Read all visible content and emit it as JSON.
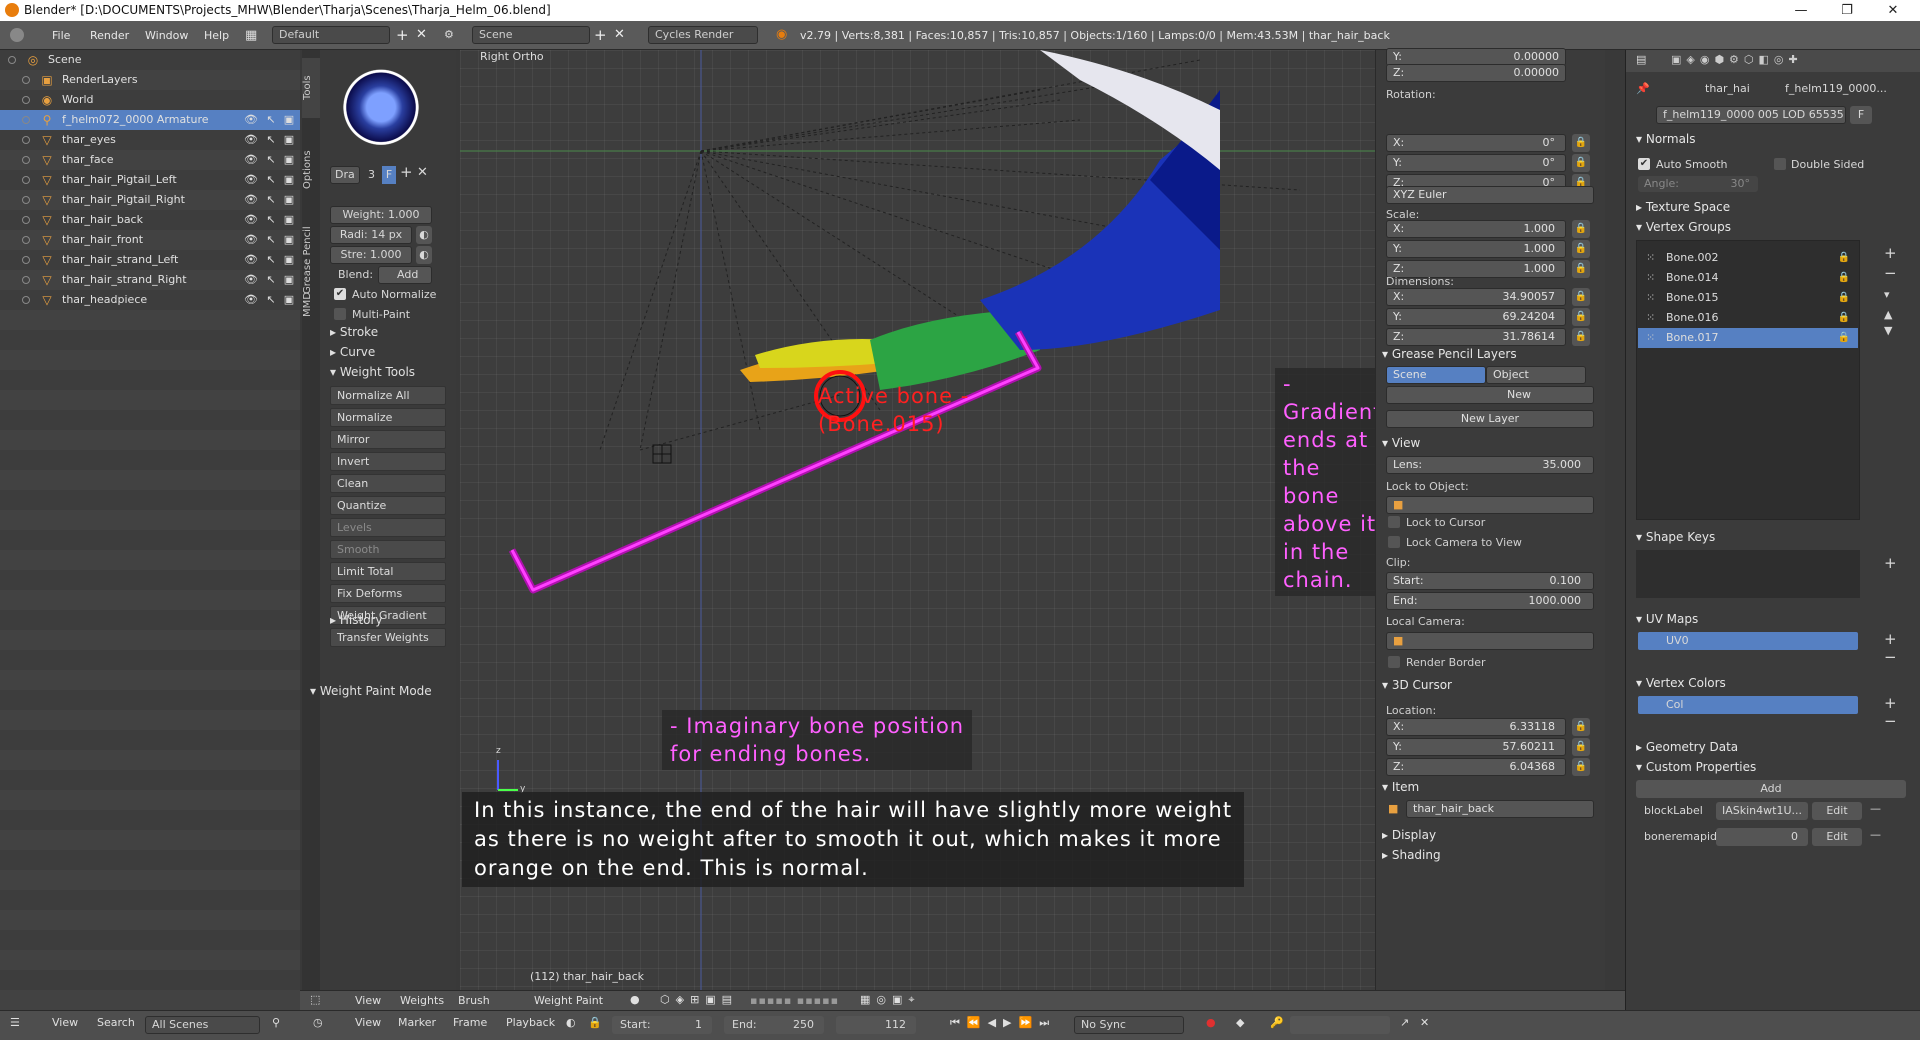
{
  "window": {
    "title": "Blender* [D:\\DOCUMENTS\\Projects_MHW\\Blender\\Tharja\\Scenes\\Tharja_Helm_06.blend]"
  },
  "infobar": {
    "menus": [
      "File",
      "Render",
      "Window",
      "Help"
    ],
    "layout": "Default",
    "scene": "Scene",
    "engine": "Cycles Render",
    "stats": "v2.79 | Verts:8,381 | Faces:10,857 | Tris:10,857 | Objects:1/160 | Lamps:0/0 | Mem:43.53M | thar_hair_back"
  },
  "outliner": {
    "items": [
      {
        "label": "Scene",
        "icon": "scene-icon"
      },
      {
        "label": "RenderLayers",
        "icon": "renderlayers-icon"
      },
      {
        "label": "World",
        "icon": "world-icon"
      },
      {
        "label": "f_helm072_0000 Armature",
        "icon": "armature-icon"
      },
      {
        "label": "thar_eyes",
        "icon": "mesh-icon"
      },
      {
        "label": "thar_face",
        "icon": "mesh-icon"
      },
      {
        "label": "thar_hair_Pigtail_Left",
        "icon": "mesh-icon"
      },
      {
        "label": "thar_hair_Pigtail_Right",
        "icon": "mesh-icon"
      },
      {
        "label": "thar_hair_back",
        "icon": "mesh-icon"
      },
      {
        "label": "thar_hair_front",
        "icon": "mesh-icon"
      },
      {
        "label": "thar_hair_strand_Left",
        "icon": "mesh-icon"
      },
      {
        "label": "thar_hair_strand_Right",
        "icon": "mesh-icon"
      },
      {
        "label": "thar_headpiece",
        "icon": "mesh-icon"
      }
    ]
  },
  "tabs": [
    "Tools",
    "Options",
    "Grease Pencil",
    "MMD"
  ],
  "toolshelf": {
    "brush_name": "Dra",
    "brush_users": "3",
    "brush_fake": "F",
    "weight": "Weight: 1.000",
    "radius": "Radi: 14 px",
    "strength": "Stre: 1.000",
    "blend_label": "Blend:",
    "blend_value": "Add",
    "auto_normalize": "Auto Normalize",
    "multi_paint": "Multi-Paint",
    "stroke": "Stroke",
    "curve": "Curve",
    "weight_tools": "Weight Tools",
    "tools": [
      "Normalize All",
      "Normalize",
      "Mirror",
      "Invert",
      "Clean",
      "Quantize",
      "Levels",
      "Smooth",
      "Limit Total",
      "Fix Deforms",
      "Weight Gradient",
      "Transfer Weights"
    ],
    "history": "History",
    "mode_panel": "Weight Paint Mode"
  },
  "viewport": {
    "view_name": "Right Ortho",
    "object_label": "(112) thar_hair_back",
    "axis_z": "z",
    "axis_y": "y"
  },
  "annotations": {
    "active_bone": [
      "Active bone -",
      "(Bone.015)"
    ],
    "gradient": [
      "- Gradient ends at the bone",
      "above it in the chain."
    ],
    "imaginary": [
      "- Imaginary bone position",
      "for ending bones."
    ],
    "note": [
      "In this instance, the end of the hair will have slightly more weight",
      "as there is no weight after to smooth it out, which makes it more",
      "orange on the end. This is normal."
    ]
  },
  "npanel": {
    "loc_y": "0.00000",
    "loc_z": "0.00000",
    "rotation_label": "Rotation:",
    "rot": [
      "0°",
      "0°",
      "0°"
    ],
    "rot_mode": "XYZ Euler",
    "scale_label": "Scale:",
    "scale": [
      "1.000",
      "1.000",
      "1.000"
    ],
    "dimensions_label": "Dimensions:",
    "dims": [
      "34.90057",
      "69.24204",
      "31.78614"
    ],
    "axes": [
      "X:",
      "Y:",
      "Z:"
    ],
    "gp_layers": "Grease Pencil Layers",
    "gp_scene": "Scene",
    "gp_object": "Object",
    "gp_new": "New",
    "new_layer": "New Layer",
    "view": "View",
    "lens_label": "Lens:",
    "lens": "35.000",
    "lock_to_object": "Lock to Object:",
    "lock_to_cursor": "Lock to Cursor",
    "lock_camera": "Lock Camera to View",
    "clip": "Clip:",
    "start_label": "Start:",
    "start": "0.100",
    "end_label": "End:",
    "end": "1000.000",
    "local_camera": "Local Camera:",
    "render_border": "Render Border",
    "cursor": "3D Cursor",
    "location_label": "Location:",
    "cursor_loc": [
      "6.33118",
      "57.60211",
      "6.04368"
    ],
    "item": "Item",
    "item_name": "thar_hair_back",
    "display": "Display",
    "shading": "Shading"
  },
  "props": {
    "context_a": "thar_hai",
    "context_b": "f_helm119_0000...",
    "mesh_name": "f_helm119_0000 005 LOD 65535",
    "mesh_fake": "F",
    "normals": "Normals",
    "auto_smooth": "Auto Smooth",
    "double_sided": "Double Sided",
    "angle_label": "Angle:",
    "angle": "30°",
    "texture_space": "Texture Space",
    "vertex_groups": "Vertex Groups",
    "groups": [
      "Bone.002",
      "Bone.014",
      "Bone.015",
      "Bone.016",
      "Bone.017"
    ],
    "shape_keys": "Shape Keys",
    "uv_maps": "UV Maps",
    "uv": "UV0",
    "vertex_colors": "Vertex Colors",
    "col": "Col",
    "geometry_data": "Geometry Data",
    "custom_properties": "Custom Properties",
    "add": "Add",
    "cp1_name": "blockLabel",
    "cp1_value": "IASkin4wt1U...",
    "cp2_name": "boneremapid",
    "cp2_value": "0",
    "edit": "Edit"
  },
  "vpheader": {
    "items": [
      "View",
      "Weights",
      "Brush",
      "Weight Paint"
    ]
  },
  "timeline": {
    "view": "View",
    "search": "Search",
    "all_scenes": "All Scenes",
    "menus": [
      "View",
      "Marker",
      "Frame",
      "Playback"
    ],
    "start_label": "Start:",
    "start": "1",
    "end_label": "End:",
    "end": "250",
    "frame": "112",
    "sync": "No Sync"
  },
  "colors": {
    "accent_blue": "#5680c2",
    "annotation_pink": "#ff40ff",
    "annotation_red": "#ff2020"
  }
}
